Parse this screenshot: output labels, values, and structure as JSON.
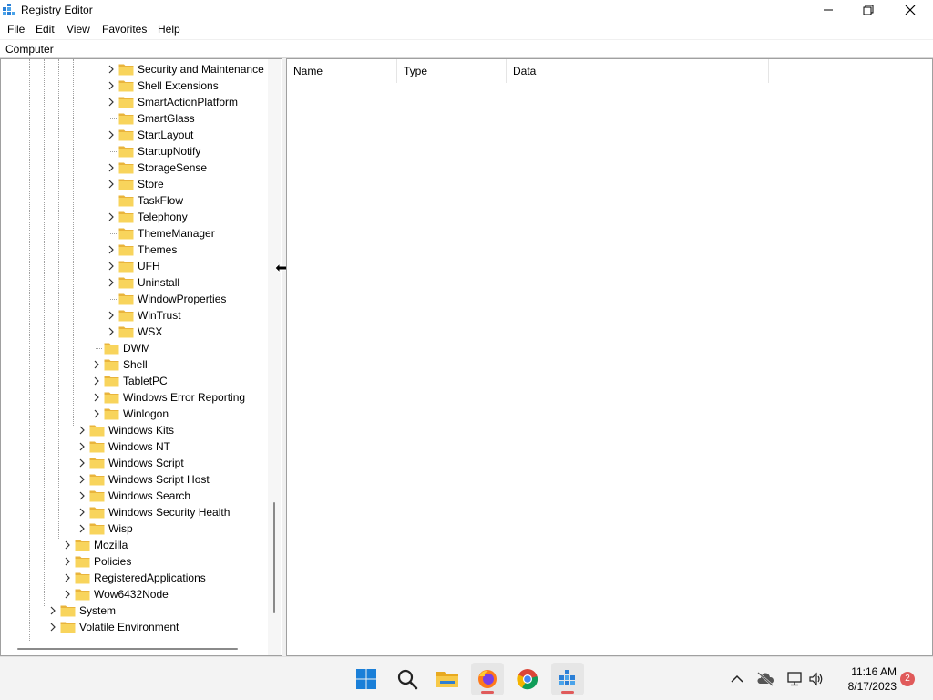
{
  "window": {
    "title": "Registry Editor"
  },
  "menu": [
    "File",
    "Edit",
    "View",
    "Favorites",
    "Help"
  ],
  "address": "Computer",
  "tree": {
    "rows": [
      {
        "label": "Security and Maintenance",
        "expandable": true
      },
      {
        "label": "Shell Extensions",
        "expandable": true
      },
      {
        "label": "SmartActionPlatform",
        "expandable": true
      },
      {
        "label": "SmartGlass",
        "expandable": false
      },
      {
        "label": "StartLayout",
        "expandable": true
      },
      {
        "label": "StartupNotify",
        "expandable": false
      },
      {
        "label": "StorageSense",
        "expandable": true
      },
      {
        "label": "Store",
        "expandable": true
      },
      {
        "label": "TaskFlow",
        "expandable": false
      },
      {
        "label": "Telephony",
        "expandable": true
      },
      {
        "label": "ThemeManager",
        "expandable": false
      },
      {
        "label": "Themes",
        "expandable": true
      },
      {
        "label": "UFH",
        "expandable": true
      },
      {
        "label": "Uninstall",
        "expandable": true
      },
      {
        "label": "WindowProperties",
        "expandable": false
      },
      {
        "label": "WinTrust",
        "expandable": true
      },
      {
        "label": "WSX",
        "expandable": true
      },
      {
        "label": "DWM",
        "expandable": false
      },
      {
        "label": "Shell",
        "expandable": true
      },
      {
        "label": "TabletPC",
        "expandable": true
      },
      {
        "label": "Windows Error Reporting",
        "expandable": true
      },
      {
        "label": "Winlogon",
        "expandable": true
      },
      {
        "label": "Windows Kits",
        "expandable": true
      },
      {
        "label": "Windows NT",
        "expandable": true
      },
      {
        "label": "Windows Script",
        "expandable": true
      },
      {
        "label": "Windows Script Host",
        "expandable": true
      },
      {
        "label": "Windows Search",
        "expandable": true
      },
      {
        "label": "Windows Security Health",
        "expandable": true
      },
      {
        "label": "Wisp",
        "expandable": true
      },
      {
        "label": "Mozilla",
        "expandable": true
      },
      {
        "label": "Policies",
        "expandable": true
      },
      {
        "label": "RegisteredApplications",
        "expandable": true
      },
      {
        "label": "Wow6432Node",
        "expandable": true
      },
      {
        "label": "System",
        "expandable": true
      },
      {
        "label": "Volatile Environment",
        "expandable": true
      }
    ]
  },
  "list": {
    "columns": [
      "Name",
      "Type",
      "Data"
    ]
  },
  "taskbar": {
    "apps": [
      "start-icon",
      "search-icon",
      "file-explorer-icon",
      "firefox-icon",
      "chrome-icon",
      "registry-editor-icon"
    ],
    "clock_time": "11:16 AM",
    "clock_date": "8/17/2023",
    "notification_count": "2"
  }
}
